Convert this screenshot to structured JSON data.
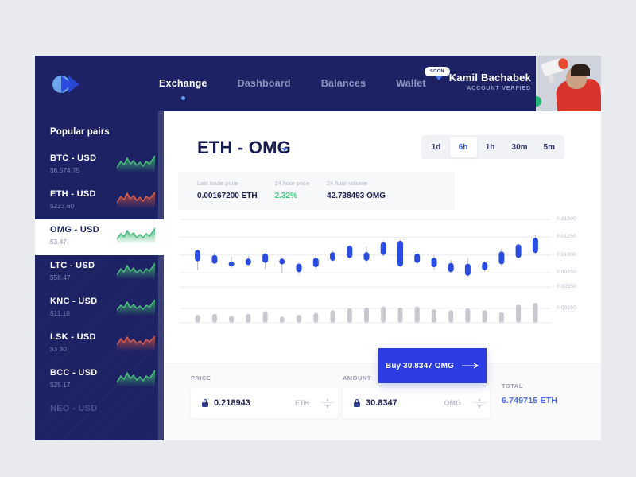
{
  "nav": {
    "links": [
      {
        "label": "Exchange",
        "active": true,
        "badge": null
      },
      {
        "label": "Dashboard",
        "active": false,
        "badge": null
      },
      {
        "label": "Balances",
        "active": false,
        "badge": null
      },
      {
        "label": "Wallet",
        "active": false,
        "badge": "SOON"
      }
    ]
  },
  "account": {
    "name": "Kamil Bachabek",
    "status": "ACCOUNT VERFIED"
  },
  "sidebar": {
    "title": "Popular pairs",
    "pairs": [
      {
        "name": "BTC - USD",
        "price": "$6.574.75",
        "trend": "up"
      },
      {
        "name": "ETH - USD",
        "price": "$223.60",
        "trend": "down"
      },
      {
        "name": "OMG - USD",
        "price": "$3.47",
        "trend": "up"
      },
      {
        "name": "LTC - USD",
        "price": "$58.47",
        "trend": "up"
      },
      {
        "name": "KNC - USD",
        "price": "$11.10",
        "trend": "up"
      },
      {
        "name": "LSK - USD",
        "price": "$3.30",
        "trend": "down"
      },
      {
        "name": "BCC - USD",
        "price": "$25.17",
        "trend": "up"
      },
      {
        "name": "NEO - USD",
        "price": "",
        "trend": "up"
      }
    ]
  },
  "market": {
    "pair_title": "ETH - OMG",
    "timeframes": [
      {
        "label": "1d",
        "active": false
      },
      {
        "label": "6h",
        "active": true
      },
      {
        "label": "1h",
        "active": false
      },
      {
        "label": "30m",
        "active": false
      },
      {
        "label": "5m",
        "active": false
      }
    ],
    "stats": [
      {
        "label": "Last trade price",
        "value": "0.00167200 ETH",
        "positive": false
      },
      {
        "label": "24 hour price",
        "value": "2.32%",
        "positive": true
      },
      {
        "label": "24 hour volume",
        "value": "42.738493 OMG",
        "positive": false
      }
    ]
  },
  "order": {
    "price_label": "PRICE",
    "price_value": "0.218943",
    "price_unit": "ETH",
    "amount_label": "AMOUNT",
    "amount_value": "30.8347",
    "amount_unit": "OMG",
    "total_label": "TOTAL",
    "total_value": "6.749715 ETH",
    "buy_label": "Buy 30.8347 OMG"
  },
  "colors": {
    "navy": "#1d2264",
    "accent_blue": "#2b3ce0",
    "positive_green": "#3ec87e",
    "candle_blue": "#2b4ce0",
    "volume_gray": "#c8c9cf"
  },
  "chart_data": {
    "type": "bar",
    "title": "ETH - OMG candlestick chart",
    "xlabel": "",
    "ylabel": "",
    "ylim": [
      0.0025,
      0.015
    ],
    "yticks": [
      "0.01500",
      "0.01250",
      "0.01000",
      "0.00750",
      "0.00550",
      "0.00250"
    ],
    "grid": true,
    "legend": "none",
    "series": [
      {
        "name": "candles",
        "ohlc": [
          {
            "open": 0.0091,
            "high": 0.0108,
            "low": 0.0079,
            "close": 0.0107
          },
          {
            "open": 0.0088,
            "high": 0.0103,
            "low": 0.0087,
            "close": 0.01
          },
          {
            "open": 0.0084,
            "high": 0.0098,
            "low": 0.0082,
            "close": 0.0091
          },
          {
            "open": 0.0086,
            "high": 0.0099,
            "low": 0.0085,
            "close": 0.0095
          },
          {
            "open": 0.0089,
            "high": 0.0103,
            "low": 0.008,
            "close": 0.0102
          },
          {
            "open": 0.0087,
            "high": 0.0097,
            "low": 0.0074,
            "close": 0.0095
          },
          {
            "open": 0.0076,
            "high": 0.009,
            "low": 0.0073,
            "close": 0.0088
          },
          {
            "open": 0.0083,
            "high": 0.01,
            "low": 0.008,
            "close": 0.0096
          },
          {
            "open": 0.0092,
            "high": 0.0106,
            "low": 0.0091,
            "close": 0.0104
          },
          {
            "open": 0.0096,
            "high": 0.0114,
            "low": 0.0095,
            "close": 0.0113
          },
          {
            "open": 0.0092,
            "high": 0.0111,
            "low": 0.0089,
            "close": 0.0104
          },
          {
            "open": 0.01,
            "high": 0.012,
            "low": 0.0098,
            "close": 0.0118
          },
          {
            "open": 0.0084,
            "high": 0.0122,
            "low": 0.0083,
            "close": 0.012
          },
          {
            "open": 0.0089,
            "high": 0.0108,
            "low": 0.0087,
            "close": 0.0102
          },
          {
            "open": 0.0083,
            "high": 0.01,
            "low": 0.0079,
            "close": 0.0096
          },
          {
            "open": 0.0076,
            "high": 0.0093,
            "low": 0.0074,
            "close": 0.0089
          },
          {
            "open": 0.0071,
            "high": 0.0096,
            "low": 0.0069,
            "close": 0.0088
          },
          {
            "open": 0.0079,
            "high": 0.0091,
            "low": 0.0077,
            "close": 0.009
          },
          {
            "open": 0.0087,
            "high": 0.0109,
            "low": 0.0084,
            "close": 0.0105
          },
          {
            "open": 0.0096,
            "high": 0.0116,
            "low": 0.0095,
            "close": 0.0115
          },
          {
            "open": 0.0103,
            "high": 0.0128,
            "low": 0.0102,
            "close": 0.0124
          }
        ]
      },
      {
        "name": "volume",
        "values": [
          6,
          7,
          5,
          7,
          10,
          4,
          6,
          8,
          11,
          13,
          14,
          15,
          14,
          15,
          12,
          11,
          13,
          11,
          9,
          17,
          19
        ]
      }
    ]
  }
}
